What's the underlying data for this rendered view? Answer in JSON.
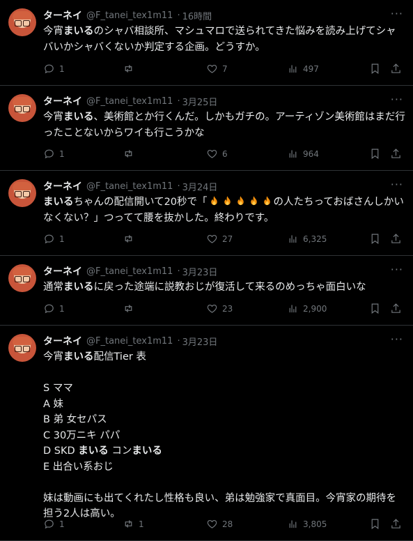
{
  "user": {
    "name": "ターネイ",
    "handle": "@F_tanei_tex1m11"
  },
  "more_label": "···",
  "tweets": [
    {
      "time": "16時間",
      "segments": [
        [
          "今宵",
          0
        ],
        [
          "まいる",
          1
        ],
        [
          "のシャバ相談所、マシュマロで送られてきた悩みを読み上げてシャバいかシャバくないか判定する企画。どうすか。",
          0
        ]
      ],
      "reply": "1",
      "retweet": "",
      "like": "7",
      "views": "497"
    },
    {
      "time": "3月25日",
      "segments": [
        [
          "今宵",
          0
        ],
        [
          "まいる",
          1
        ],
        [
          "、美術館とか行くんだ。しかもガチの。アーティゾン美術館はまだ行ったことないからワイも行こうかな",
          0
        ]
      ],
      "reply": "1",
      "retweet": "",
      "like": "6",
      "views": "964"
    },
    {
      "time": "3月24日",
      "segments": [
        [
          "まいる",
          1
        ],
        [
          "ちゃんの配信開いて20秒で「",
          0
        ],
        [
          "🔥🔥🔥🔥🔥",
          2
        ],
        [
          "の人たちっておばさんしかいなくない？」つってて腰を抜かした。終わりです。",
          0
        ]
      ],
      "reply": "1",
      "retweet": "",
      "like": "27",
      "views": "6,325"
    },
    {
      "time": "3月23日",
      "segments": [
        [
          "通常",
          0
        ],
        [
          "まいる",
          1
        ],
        [
          "に戻った途端に説教おじが復活して来るのめっちゃ面白いな",
          0
        ]
      ],
      "reply": "1",
      "retweet": "",
      "like": "23",
      "views": "2,900"
    },
    {
      "time": "3月23日",
      "segments": [
        [
          "今宵",
          0
        ],
        [
          "まいる",
          1
        ],
        [
          "配信Tier 表\n\nS ママ\nA 妹\nB 弟 女セパス\nC 30万ニキ パパ\nD SKD ",
          0
        ],
        [
          "まいる",
          1
        ],
        [
          " コン",
          0
        ],
        [
          "まいる",
          1
        ],
        [
          "\nE 出合い系おじ\n\n妹は動画にも出てくれたし性格も良い、弟は勉強家で真面目。今宵家の期待を担う2人は高い。",
          0
        ]
      ],
      "reply": "1",
      "retweet": "1",
      "like": "28",
      "views": "3,805"
    }
  ]
}
